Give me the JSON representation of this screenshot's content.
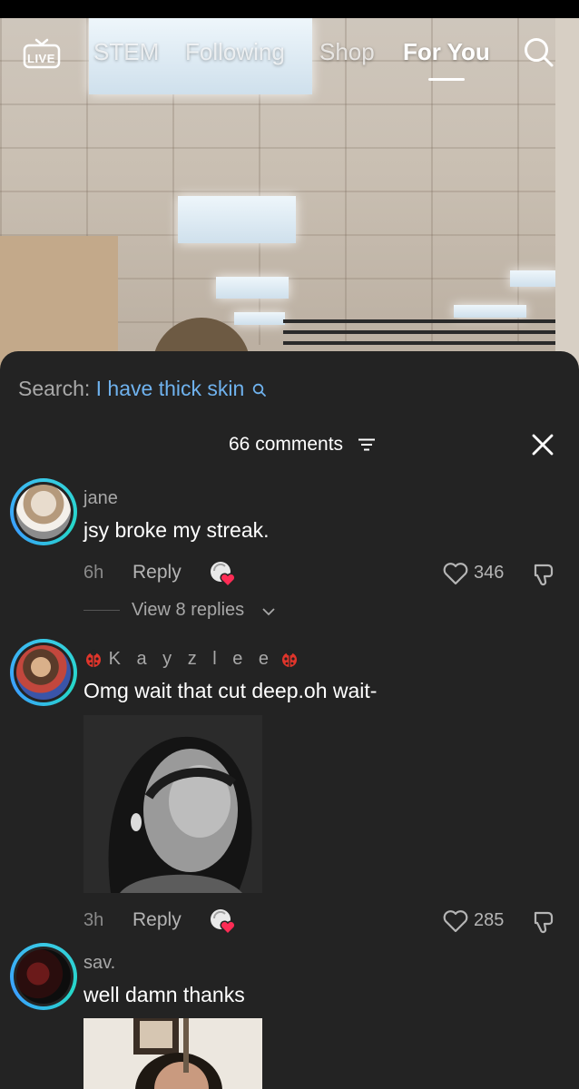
{
  "nav": {
    "live_label": "LIVE",
    "tabs": [
      {
        "label": "STEM",
        "active": false
      },
      {
        "label": "Following",
        "active": false
      },
      {
        "label": "Shop",
        "active": false
      },
      {
        "label": "For You",
        "active": true
      }
    ],
    "icons": {
      "live": "live-tv-icon",
      "search": "search-icon"
    }
  },
  "sheet": {
    "search_prefix": "Search:",
    "search_term": "I have thick skin",
    "comments_count": "66 comments",
    "icons": {
      "filter": "filter-icon",
      "close": "close-icon"
    }
  },
  "comments": [
    {
      "username": "jane",
      "text": "jsy broke my streak.",
      "time": "6h",
      "reply_label": "Reply",
      "likes": "346",
      "view_replies": "View 8 replies"
    },
    {
      "username": "K a y z l e e",
      "username_emoji": "ladybug",
      "text": "Omg wait that cut deep.oh wait-",
      "time": "3h",
      "reply_label": "Reply",
      "likes": "285",
      "has_image": true
    },
    {
      "username": "sav.",
      "text": "well damn thanks",
      "has_image": true
    }
  ],
  "colors": {
    "sheet_bg": "#232323",
    "search_term": "#6fb2ee",
    "avatar_ring": "#39c9e6",
    "react_heart": "#fe2c55"
  }
}
